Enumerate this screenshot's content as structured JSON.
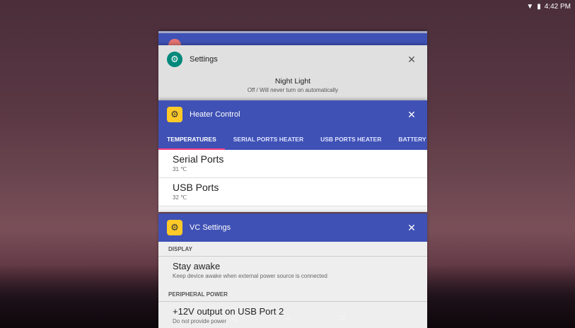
{
  "status": {
    "time": "4:42 PM",
    "wifi_icon": "wifi-icon",
    "battery_icon": "battery-icon"
  },
  "cards": {
    "settings": {
      "title": "Settings",
      "icon": "gear-icon",
      "item_title": "Night Light",
      "item_subtitle": "Off / Will never turn on automatically"
    },
    "heater": {
      "title": "Heater Control",
      "icon": "thermostat-icon",
      "tabs": [
        "TEMPERATURES",
        "SERIAL PORTS HEATER",
        "USB PORTS HEATER",
        "BATTERY HI"
      ],
      "rows": [
        {
          "title": "Serial Ports",
          "value": "31 ℃"
        },
        {
          "title": "USB Ports",
          "value": "32 ℃"
        }
      ]
    },
    "vc": {
      "title": "VC Settings",
      "icon": "settings-chip-icon",
      "sections": [
        {
          "header": "DISPLAY",
          "pref_title": "Stay awake",
          "pref_subtitle": "Keep device awake when external power source is connected"
        },
        {
          "header": "PERIPHERAL POWER",
          "pref_title": "+12V output on USB Port 2",
          "pref_subtitle": "Do not provide power"
        }
      ]
    }
  },
  "close_glyph": "✕",
  "nav": {
    "back_icon": "back-icon",
    "home_icon": "home-icon",
    "recents_icon": "recents-icon"
  }
}
